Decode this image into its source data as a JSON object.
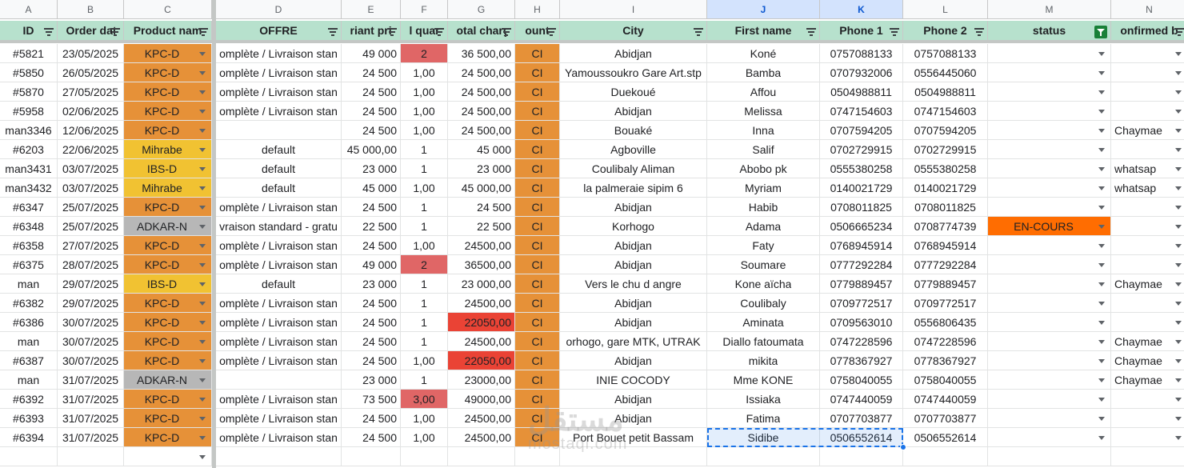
{
  "sheet": {
    "column_letters": [
      "A",
      "B",
      "C",
      "D",
      "E",
      "F",
      "G",
      "H",
      "I",
      "J",
      "K",
      "L",
      "M",
      "N"
    ],
    "selected_columns": [
      "J",
      "K"
    ],
    "headers": [
      "ID",
      "Order dat",
      "Product nam",
      "OFFRE",
      "riant pri",
      "l quan",
      "otal charg",
      "ount",
      "City",
      "First name",
      "Phone 1",
      "Phone 2",
      "status",
      "onfirmed b"
    ],
    "rows": [
      [
        "#5821",
        "23/05/2025",
        "KPC-D",
        "omplète / Livraison stan",
        "49 000",
        "2",
        "36 500,00",
        "CI",
        "Abidjan",
        "Koné",
        "0757088133",
        "0757088133",
        "",
        ""
      ],
      [
        "#5850",
        "26/05/2025",
        "KPC-D",
        "omplète / Livraison stan",
        "24 500",
        "1,00",
        "24 500,00",
        "CI",
        "Yamoussoukro  Gare  Art.stp",
        "Bamba",
        "0707932006",
        "0556445060",
        "",
        ""
      ],
      [
        "#5870",
        "27/05/2025",
        "KPC-D",
        "omplète / Livraison stan",
        "24 500",
        "1,00",
        "24 500,00",
        "CI",
        "Duekoué",
        "Affou",
        "0504988811",
        "0504988811",
        "",
        ""
      ],
      [
        "#5958",
        "02/06/2025",
        "KPC-D",
        "omplète / Livraison stan",
        "24 500",
        "1,00",
        "24 500,00",
        "CI",
        "Abidjan",
        "Melissa",
        "0747154603",
        "0747154603",
        "",
        ""
      ],
      [
        "man3346",
        "12/06/2025",
        "KPC-D",
        "",
        "24 500",
        "1,00",
        "24 500,00",
        "CI",
        "Bouaké",
        "Inna",
        "0707594205",
        "0707594205",
        "",
        "Chaymae"
      ],
      [
        "#6203",
        "22/06/2025",
        "Mihrabe",
        "default",
        "45 000,00",
        "1",
        "45 000",
        "CI",
        "Agboville",
        "Salif",
        "0702729915",
        "0702729915",
        "",
        ""
      ],
      [
        "man3431",
        "03/07/2025",
        "IBS-D",
        "default",
        "23 000",
        "1",
        "23 000",
        "CI",
        "Coulibaly Aliman",
        "Abobo pk",
        "0555380258",
        "0555380258",
        "",
        "whatsap"
      ],
      [
        "man3432",
        "03/07/2025",
        "Mihrabe",
        "default",
        "45 000",
        "1,00",
        "45 000,00",
        "CI",
        "la palmeraie sipim 6",
        "Myriam",
        "0140021729",
        "0140021729",
        "",
        "whatsap"
      ],
      [
        "#6347",
        "25/07/2025",
        "KPC-D",
        "omplète / Livraison stan",
        "24 500",
        "1",
        "24 500",
        "CI",
        "Abidjan",
        "Habib",
        "0708011825",
        "0708011825",
        "",
        ""
      ],
      [
        "#6348",
        "25/07/2025",
        "ADKAR-N",
        "vraison standard - gratu",
        "22 500",
        "1",
        "22 500",
        "CI",
        "Korhogo",
        "Adama",
        "0506665234",
        "0708774739",
        "EN-COURS",
        ""
      ],
      [
        "#6358",
        "27/07/2025",
        "KPC-D",
        "omplète / Livraison stan",
        "24 500",
        "1,00",
        "24500,00",
        "CI",
        "Abidjan",
        "Faty",
        "0768945914",
        "0768945914",
        "",
        ""
      ],
      [
        "#6375",
        "28/07/2025",
        "KPC-D",
        "omplète / Livraison stan",
        "49 000",
        "2",
        "36500,00",
        "CI",
        "Abidjan",
        "Soumare",
        "0777292284",
        "0777292284",
        "",
        ""
      ],
      [
        "man",
        "29/07/2025",
        "IBS-D",
        "default",
        "23 000",
        "1",
        "23 000,00",
        "CI",
        "Vers le chu d angre",
        "Kone aïcha",
        "0779889457",
        "0779889457",
        "",
        "Chaymae"
      ],
      [
        "#6382",
        "29/07/2025",
        "KPC-D",
        "omplète / Livraison stan",
        "24 500",
        "1",
        "24500,00",
        "CI",
        "Abidjan",
        "Coulibaly",
        "0709772517",
        "0709772517",
        "",
        ""
      ],
      [
        "#6386",
        "30/07/2025",
        "KPC-D",
        "omplète / Livraison stan",
        "24 500",
        "1",
        "22050,00",
        "CI",
        "Abidjan",
        "Aminata",
        "0709563010",
        "0556806435",
        "",
        ""
      ],
      [
        "man",
        "30/07/2025",
        "KPC-D",
        "omplète / Livraison stan",
        "24 500",
        "1",
        "24500,00",
        "CI",
        "orhogo,  gare MTK, UTRAK",
        "Diallo fatoumata",
        "0747228596",
        "0747228596",
        "",
        "Chaymae"
      ],
      [
        "#6387",
        "30/07/2025",
        "KPC-D",
        "omplète / Livraison stan",
        "24 500",
        "1,00",
        "22050,00",
        "CI",
        "Abidjan",
        "mikita",
        "0778367927",
        "0778367927",
        "",
        "Chaymae"
      ],
      [
        "man",
        "31/07/2025",
        "ADKAR-N",
        "",
        "23 000",
        "1",
        "23000,00",
        "CI",
        "INIE COCODY",
        "Mme KONE",
        "0758040055",
        "0758040055",
        "",
        "Chaymae"
      ],
      [
        "#6392",
        "31/07/2025",
        "KPC-D",
        "omplète / Livraison stan",
        "73 500",
        "3,00",
        "49000,00",
        "CI",
        "Abidjan",
        "Issiaka",
        "0747440059",
        "0747440059",
        "",
        ""
      ],
      [
        "#6393",
        "31/07/2025",
        "KPC-D",
        "omplète / Livraison stan",
        "24 500",
        "1,00",
        "24500,00",
        "CI",
        "Abidjan",
        "Fatima",
        "0707703877",
        "0707703877",
        "",
        ""
      ],
      [
        "#6394",
        "31/07/2025",
        "KPC-D",
        "omplète / Livraison stan",
        "24 500",
        "1,00",
        "24500,00",
        "CI",
        "Port Bouet petit Bassam",
        "Sidibe",
        "0506552614",
        "0506552614",
        "",
        ""
      ]
    ]
  },
  "watermark": {
    "arabic": "مستقل",
    "latin": "mostaql.com"
  },
  "colors": {
    "header_bg": "#b7e1cd",
    "kpc": "#e69138",
    "mihrabe": "#f1c232",
    "adkar": "#b7b7b7",
    "country": "#e69138",
    "qty_highlight": "#e06666",
    "charge_highlight": "#ea4335",
    "status_en_cours": "#ff6d01",
    "selection": "#1a73e8"
  }
}
